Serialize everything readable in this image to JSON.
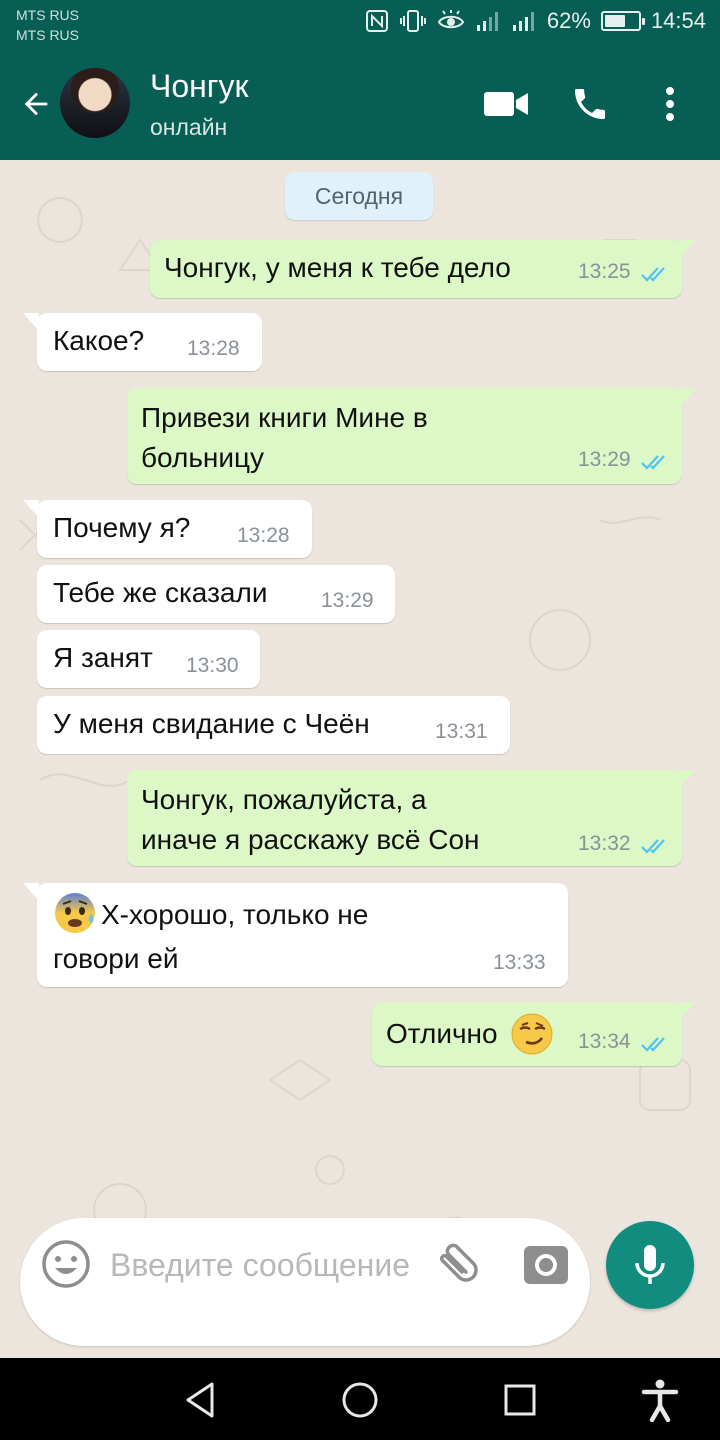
{
  "status_bar": {
    "carrier1": "MTS RUS",
    "carrier2": "MTS RUS",
    "battery": "62%",
    "battery_level": 0.62,
    "time": "14:54",
    "icons": [
      "nfc-icon",
      "vibrate-icon",
      "eye-comfort-icon",
      "signal-icon",
      "signal-icon",
      "battery-icon"
    ]
  },
  "header": {
    "contact_name": "Чонгук",
    "contact_status": "онлайн",
    "icons": [
      "back-arrow-icon",
      "video-call-icon",
      "phone-icon",
      "more-vert-icon"
    ]
  },
  "chat": {
    "date_label": "Сегодня",
    "messages": [
      {
        "dir": "out",
        "lines": [
          "Чонгук, у меня к тебе дело"
        ],
        "time": "13:25",
        "read": true
      },
      {
        "dir": "in",
        "lines": [
          "Какое?"
        ],
        "time": "13:28"
      },
      {
        "dir": "out",
        "lines": [
          "Привези книги Мине в",
          "больницу"
        ],
        "time": "13:29",
        "read": true
      },
      {
        "dir": "in",
        "lines": [
          "Почему я?"
        ],
        "time": "13:28"
      },
      {
        "dir": "in",
        "lines": [
          "Тебе же сказали"
        ],
        "time": "13:29"
      },
      {
        "dir": "in",
        "lines": [
          "Я занят"
        ],
        "time": "13:30"
      },
      {
        "dir": "in",
        "lines": [
          "У меня свидание с Чеён"
        ],
        "time": "13:31"
      },
      {
        "dir": "out",
        "lines": [
          "Чонгук, пожалуйста, а",
          "иначе я расскажу всё Сон"
        ],
        "time": "13:32",
        "read": true
      },
      {
        "dir": "in",
        "lines": [
          "Х-хорошо, только не",
          "говори ей"
        ],
        "time": "13:33",
        "emoji": "anxious-face-with-sweat"
      },
      {
        "dir": "out",
        "lines": [
          "Отлично"
        ],
        "time": "13:34",
        "read": true,
        "emoji": "smirking-face"
      }
    ]
  },
  "composer": {
    "placeholder": "Введите сообщение",
    "icons": [
      "emoji-icon",
      "attach-icon",
      "camera-icon",
      "mic-icon"
    ]
  },
  "nav_bar": {
    "icons": [
      "back-triangle-icon",
      "home-circle-icon",
      "recents-square-icon",
      "accessibility-icon"
    ]
  },
  "colors": {
    "header": "#075e54",
    "outgoing_bubble": "#dcf8c6",
    "incoming_bubble": "#ffffff",
    "read_ticks": "#4fc3f7",
    "mic_button": "#128c7e",
    "chat_background": "#ece5dd"
  }
}
